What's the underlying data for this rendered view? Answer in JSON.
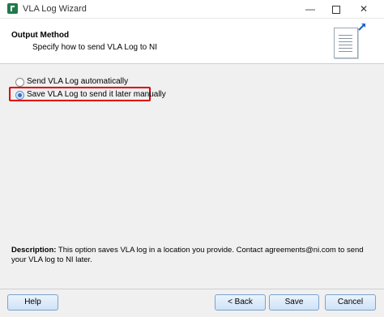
{
  "window": {
    "title": "VLA Log Wizard",
    "minimize_glyph": "—",
    "close_glyph": "✕"
  },
  "header": {
    "title": "Output Method",
    "subtitle": "Specify how to send VLA Log to NI"
  },
  "options": [
    {
      "label": "Send VLA Log automatically",
      "selected": false
    },
    {
      "label": "Save VLA Log to send it later manually",
      "selected": true
    }
  ],
  "description": {
    "label": "Description:",
    "text": "This option saves VLA log in a location you provide. Contact agreements@ni.com to send your VLA log to NI later."
  },
  "buttons": {
    "help": "Help",
    "back": "< Back",
    "save": "Save",
    "cancel": "Cancel"
  },
  "colors": {
    "highlight": "#e10000",
    "app_icon": "#1f7a4a",
    "button_border": "#7da2ce"
  }
}
